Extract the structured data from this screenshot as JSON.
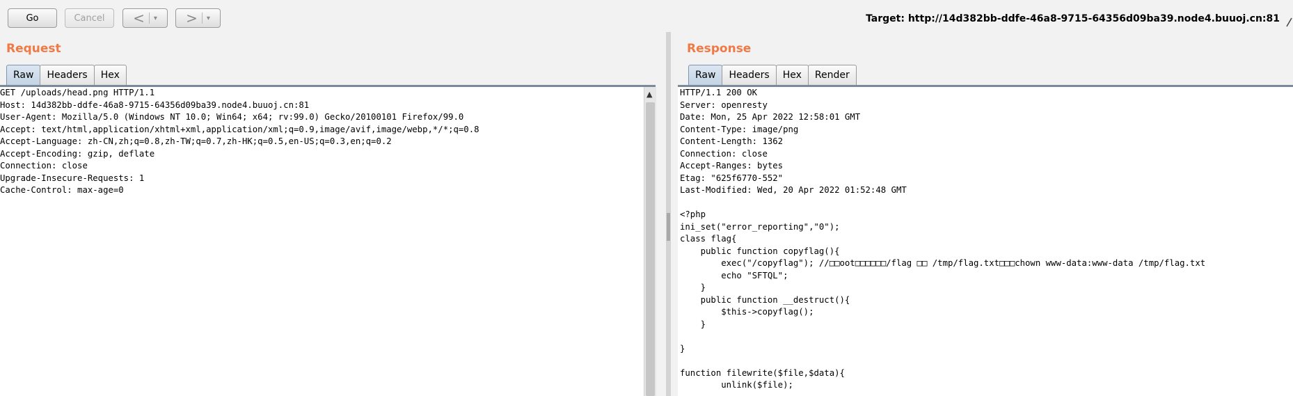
{
  "toolbar": {
    "go_label": "Go",
    "cancel_label": "Cancel",
    "back_glyph": "<",
    "forward_glyph": ">",
    "dropdown_glyph": "▾",
    "target_text": "Target: http://14d382bb-ddfe-46a8-9715-64356d09ba39.node4.buuoj.cn:81"
  },
  "request": {
    "title": "Request",
    "tabs": [
      "Raw",
      "Headers",
      "Hex"
    ],
    "active_tab": "Raw",
    "lines": [
      "GET /uploads/head.png HTTP/1.1",
      "Host: 14d382bb-ddfe-46a8-9715-64356d09ba39.node4.buuoj.cn:81",
      "User-Agent: Mozilla/5.0 (Windows NT 10.0; Win64; x64; rv:99.0) Gecko/20100101 Firefox/99.0",
      "Accept: text/html,application/xhtml+xml,application/xml;q=0.9,image/avif,image/webp,*/*;q=0.8",
      "Accept-Language: zh-CN,zh;q=0.8,zh-TW;q=0.7,zh-HK;q=0.5,en-US;q=0.3,en;q=0.2",
      "Accept-Encoding: gzip, deflate",
      "Connection: close",
      "Upgrade-Insecure-Requests: 1",
      "Cache-Control: max-age=0"
    ]
  },
  "response": {
    "title": "Response",
    "tabs": [
      "Raw",
      "Headers",
      "Hex",
      "Render"
    ],
    "active_tab": "Raw",
    "lines": [
      "HTTP/1.1 200 OK",
      "Server: openresty",
      "Date: Mon, 25 Apr 2022 12:58:01 GMT",
      "Content-Type: image/png",
      "Content-Length: 1362",
      "Connection: close",
      "Accept-Ranges: bytes",
      "Etag: \"625f6770-552\"",
      "Last-Modified: Wed, 20 Apr 2022 01:52:48 GMT",
      "",
      "<?php",
      "ini_set(\"error_reporting\",\"0\");",
      "class flag{",
      "    public function copyflag(){",
      "        exec(\"/copyflag\"); //□□oot□□□□□□/flag □□ /tmp/flag.txt□□□chown www-data:www-data /tmp/flag.txt",
      "        echo \"SFTQL\";",
      "    }",
      "    public function __destruct(){",
      "        $this->copyflag();",
      "    }",
      "",
      "}",
      "",
      "function filewrite($file,$data){",
      "        unlink($file);"
    ]
  },
  "colors": {
    "pane_title": "#f07a46",
    "active_tab": "#c4d4e6",
    "editor_bg": "#ffffff"
  }
}
